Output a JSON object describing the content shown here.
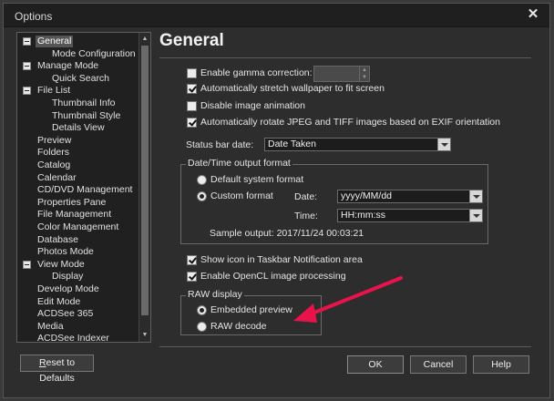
{
  "window": {
    "title": "Options"
  },
  "tree": {
    "items": [
      {
        "label": "General",
        "level": 0,
        "expander": true,
        "selected": true
      },
      {
        "label": "Mode Configuration",
        "level": 1
      },
      {
        "label": "Manage Mode",
        "level": 0,
        "expander": true
      },
      {
        "label": "Quick Search",
        "level": 1
      },
      {
        "label": "File List",
        "level": 0,
        "expander": true
      },
      {
        "label": "Thumbnail Info",
        "level": 1
      },
      {
        "label": "Thumbnail Style",
        "level": 1
      },
      {
        "label": "Details View",
        "level": 1
      },
      {
        "label": "Preview",
        "level": 0
      },
      {
        "label": "Folders",
        "level": 0
      },
      {
        "label": "Catalog",
        "level": 0
      },
      {
        "label": "Calendar",
        "level": 0
      },
      {
        "label": "CD/DVD Management",
        "level": 0
      },
      {
        "label": "Properties Pane",
        "level": 0
      },
      {
        "label": "File Management",
        "level": 0
      },
      {
        "label": "Color Management",
        "level": 0
      },
      {
        "label": "Database",
        "level": 0
      },
      {
        "label": "Photos Mode",
        "level": 0
      },
      {
        "label": "View Mode",
        "level": 0,
        "expander": true
      },
      {
        "label": "Display",
        "level": 1
      },
      {
        "label": "Develop Mode",
        "level": 0
      },
      {
        "label": "Edit Mode",
        "level": 0
      },
      {
        "label": "ACDSee 365",
        "level": 0
      },
      {
        "label": "Media",
        "level": 0
      },
      {
        "label": "ACDSee Indexer",
        "level": 0
      }
    ]
  },
  "reset_button": {
    "prefix": "R",
    "rest": "eset to Defaults"
  },
  "page": {
    "heading": "General"
  },
  "options": {
    "gamma": {
      "label": "Enable gamma correction:",
      "checked": false,
      "value": ""
    },
    "stretch": {
      "label": "Automatically stretch wallpaper to fit screen",
      "checked": true
    },
    "disable_anim": {
      "label": "Disable image animation",
      "checked": false
    },
    "rotate": {
      "label": "Automatically rotate JPEG and TIFF images based on EXIF orientation",
      "checked": true
    },
    "status_bar_label": "Status bar date:",
    "status_bar_value": "Date Taken"
  },
  "datetime": {
    "title": "Date/Time output format",
    "default_label": "Default system format",
    "custom_label": "Custom format",
    "custom_selected": true,
    "date_label": "Date:",
    "date_value": "yyyy/MM/dd",
    "time_label": "Time:",
    "time_value": "HH:mm:ss",
    "sample_label": "Sample output:",
    "sample_value": "2017/11/24 00:03:21"
  },
  "taskbar": {
    "label": "Show icon in Taskbar Notification area",
    "checked": true
  },
  "opencl": {
    "label": "Enable OpenCL image processing",
    "checked": true
  },
  "raw": {
    "title": "RAW display",
    "embedded_label": "Embedded preview",
    "decode_label": "RAW decode",
    "embedded_selected": true
  },
  "buttons": {
    "ok": "OK",
    "cancel": "Cancel",
    "help": "Help"
  },
  "colors": {
    "annotation_arrow": "#e8134a"
  }
}
